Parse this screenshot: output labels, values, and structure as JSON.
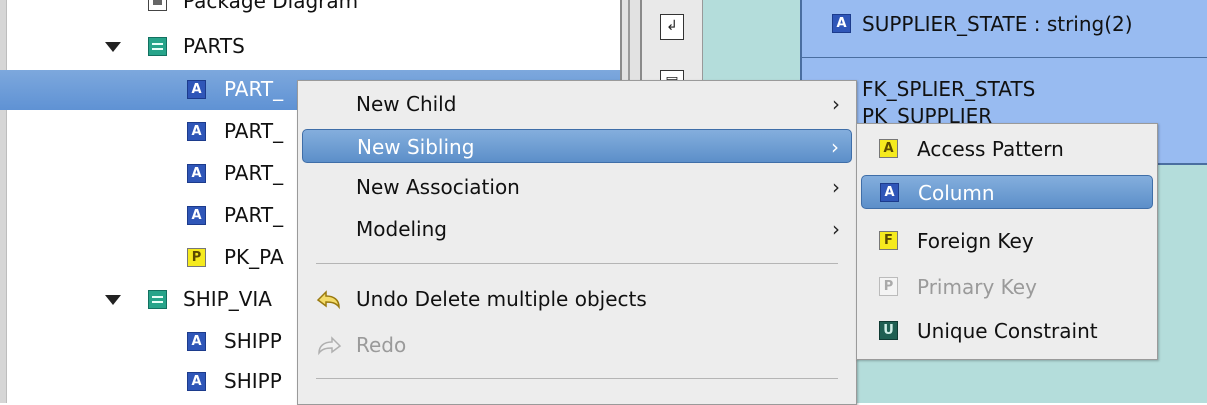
{
  "tree": {
    "items": [
      {
        "label": "Package Diagram",
        "icon": "package-diagram-icon"
      },
      {
        "label": "PARTS",
        "icon": "table-icon"
      },
      {
        "label": "PART_",
        "icon": "column-icon",
        "selected": true
      },
      {
        "label": "PART_",
        "icon": "column-icon"
      },
      {
        "label": "PART_",
        "icon": "column-icon"
      },
      {
        "label": "PART_",
        "icon": "column-icon"
      },
      {
        "label": "PK_PA",
        "icon": "primary-key-icon"
      },
      {
        "label": "SHIP_VIA",
        "icon": "table-icon"
      },
      {
        "label": "SHIPP",
        "icon": "column-icon"
      },
      {
        "label": "SHIPP",
        "icon": "column-icon"
      }
    ],
    "icon_letters": {
      "column": "A",
      "primary_key": "P"
    }
  },
  "diagram": {
    "entity_column": "SUPPLIER_STATE : string(2)",
    "entity_fk": "FK_SPLIER_STATS",
    "entity_pk": "PK_SUPPLIER"
  },
  "context_menu": {
    "items": [
      {
        "label": "New Child",
        "submenu": true
      },
      {
        "label": "New Sibling",
        "submenu": true,
        "highlighted": true
      },
      {
        "label": "New Association",
        "submenu": true
      },
      {
        "label": "Modeling",
        "submenu": true
      },
      {
        "label": "Undo Delete multiple objects",
        "icon": "undo-icon"
      },
      {
        "label": "Redo",
        "icon": "redo-icon",
        "disabled": true
      }
    ]
  },
  "submenu": {
    "items": [
      {
        "label": "Access Pattern",
        "letter": "A",
        "icon": "access-pattern-icon"
      },
      {
        "label": "Column",
        "letter": "A",
        "icon": "column-icon",
        "highlighted": true
      },
      {
        "label": "Foreign Key",
        "letter": "F",
        "icon": "foreign-key-icon"
      },
      {
        "label": "Primary Key",
        "letter": "P",
        "icon": "primary-key-icon",
        "disabled": true
      },
      {
        "label": "Unique Constraint",
        "letter": "U",
        "icon": "unique-constraint-icon"
      }
    ]
  },
  "colors": {
    "selection": "#5f92d4",
    "menu_background": "#ededed",
    "menu_highlight": "#5c8fc9",
    "diagram_canvas": "#b4dddb",
    "entity_fill": "#98bbf1"
  }
}
